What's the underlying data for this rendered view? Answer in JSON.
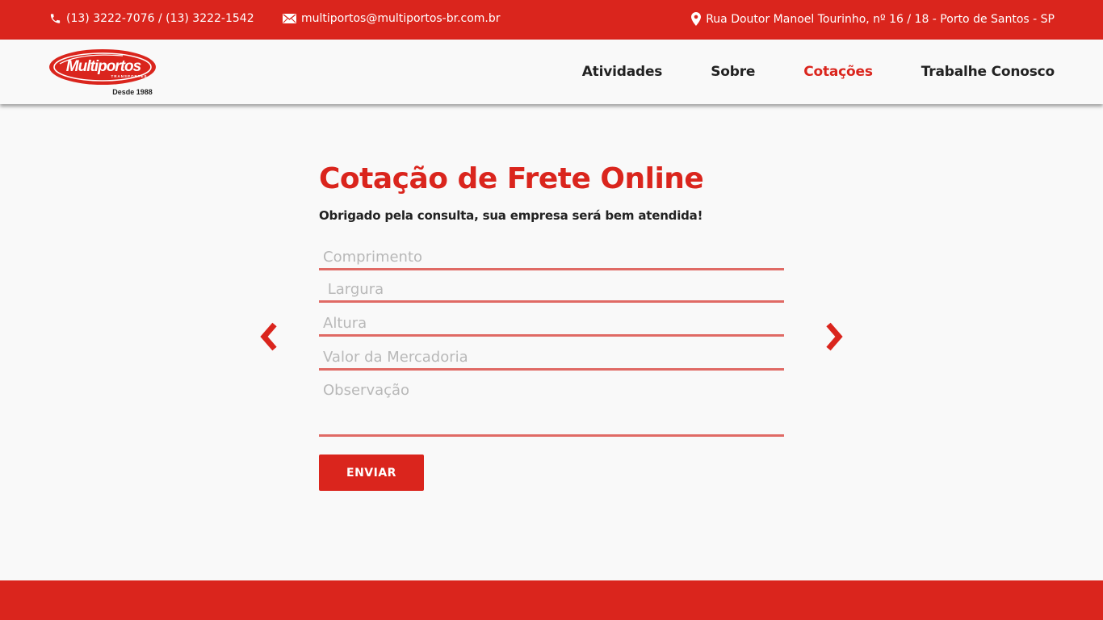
{
  "topbar": {
    "phone": "(13) 3222-7076 / (13) 3222-1542",
    "email": "multiportos@multiportos-br.com.br",
    "address": "Rua Doutor Manoel Tourinho, nº 16 / 18 - Porto de Santos - SP",
    "icons": [
      "phone-icon",
      "mail-icon",
      "map-pin-icon"
    ]
  },
  "logo": {
    "name": "Multiportos",
    "tagline": "TRANSPORTES",
    "since": "Desde 1988"
  },
  "nav": {
    "items": [
      {
        "label": "Atividades",
        "active": false
      },
      {
        "label": "Sobre",
        "active": false
      },
      {
        "label": "Cotações",
        "active": true
      },
      {
        "label": "Trabalhe Conosco",
        "active": false
      }
    ]
  },
  "form": {
    "title": "Cotação de Frete Online",
    "subtitle": "Obrigado pela consulta, sua empresa será bem atendida!",
    "fields": {
      "comprimento": {
        "placeholder": "Comprimento",
        "value": ""
      },
      "largura": {
        "placeholder": " Largura",
        "value": ""
      },
      "altura": {
        "placeholder": "Altura",
        "value": ""
      },
      "valor": {
        "placeholder": "Valor da Mercadoria",
        "value": ""
      },
      "observacao": {
        "placeholder": "Observação",
        "value": ""
      }
    },
    "submit_label": "ENVIAR",
    "prev_icon": "chevron-left-icon",
    "next_icon": "chevron-right-icon"
  },
  "colors": {
    "brand_red": "#da251d",
    "field_underline": "#e06a65",
    "background": "#f9f9f9",
    "text_dark": "#222222",
    "placeholder": "#b8b8b8"
  }
}
